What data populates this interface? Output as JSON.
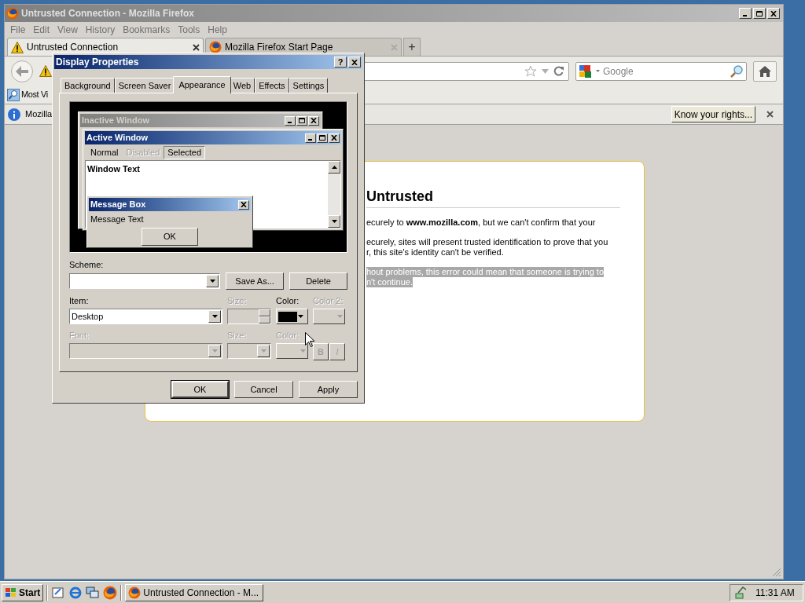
{
  "browser": {
    "title": "Untrusted Connection - Mozilla Firefox",
    "menu": [
      "File",
      "Edit",
      "View",
      "History",
      "Bookmarks",
      "Tools",
      "Help"
    ],
    "tabs": [
      {
        "label": "Untrusted Connection",
        "selected": true,
        "kind": "warning"
      },
      {
        "label": "Mozilla Firefox Start Page",
        "selected": false,
        "kind": "firefox"
      }
    ],
    "new_tab": "+",
    "search": {
      "placeholder": "Google"
    },
    "bookmarks": [
      "Most Vi"
    ],
    "notification": {
      "text": "Mozilla",
      "button": "Know your rights..."
    },
    "page": {
      "heading": "Untrusted",
      "paragraphs": [
        {
          "highlighted": false,
          "lines": [
            "ecurely to **www.mozilla.com**, but we can't confirm that your"
          ]
        },
        {
          "highlighted": false,
          "lines": [
            "ecurely, sites will present trusted identification to prove that you",
            "r, this site's identity can't be verified."
          ]
        },
        {
          "highlighted": true,
          "lines": [
            "hout problems, this error could mean that someone is trying to",
            "n't continue."
          ]
        }
      ]
    }
  },
  "dialog": {
    "title": "Display Properties",
    "help": "?",
    "tabs": [
      {
        "label": "Background",
        "selected": false
      },
      {
        "label": "Screen Saver",
        "selected": false
      },
      {
        "label": "Appearance",
        "selected": true
      },
      {
        "label": "Web",
        "selected": false
      },
      {
        "label": "Effects",
        "selected": false
      },
      {
        "label": "Settings",
        "selected": false
      }
    ],
    "preview": {
      "inactive_title": "Inactive Window",
      "active_title": "Active Window",
      "menu": [
        {
          "label": "Normal",
          "kind": "normal"
        },
        {
          "label": "Disabled",
          "kind": "disabled"
        },
        {
          "label": "Selected",
          "kind": "selected"
        }
      ],
      "window_text": "Window Text",
      "message_title": "Message Box",
      "message_text": "Message Text",
      "message_button": "OK"
    },
    "scheme": {
      "label": "Scheme:"
    },
    "save_as": "Save As...",
    "delete": "Delete",
    "item": {
      "label": "Item:",
      "value": "Desktop"
    },
    "item_size": {
      "label": "Size:",
      "disabled": true
    },
    "item_color": {
      "label": "Color:",
      "disabled": false,
      "color": "#000000"
    },
    "item_color2": {
      "label": "Color 2:",
      "disabled": true
    },
    "font": {
      "label": "Font:",
      "disabled": true
    },
    "font_size": {
      "label": "Size:",
      "disabled": true
    },
    "font_color": {
      "label": "Color:",
      "disabled": true
    },
    "bold": {
      "label": "B",
      "disabled": true
    },
    "italic": {
      "label": "I",
      "disabled": true
    },
    "buttons": [
      {
        "label": "OK",
        "default": true
      },
      {
        "label": "Cancel",
        "default": false
      },
      {
        "label": "Apply",
        "default": false
      }
    ]
  },
  "taskbar": {
    "start": "Start",
    "tasks": [
      {
        "label": "Untrusted Connection - M...",
        "selected": false
      }
    ],
    "clock": "11:31 AM"
  }
}
